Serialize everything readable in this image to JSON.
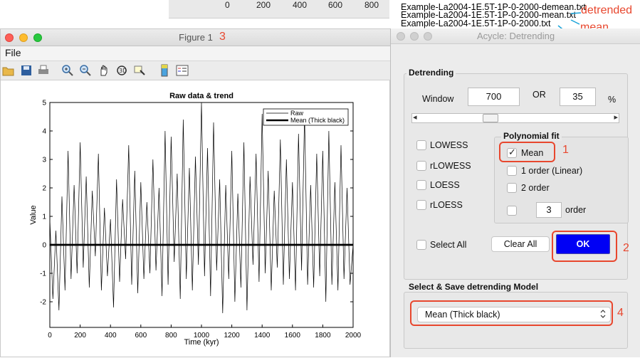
{
  "background": {
    "axis_ticks": [
      "0",
      "200",
      "400",
      "600",
      "800"
    ],
    "file_list": [
      "Example-La2004-1E.5T-1P-0-2000-demean.txt",
      "Example-La2004-1E.5T-1P-0-2000-mean.txt",
      "Example-La2004-1E.5T-1P-0-2000.txt"
    ],
    "annotations": {
      "detrended": "detrended",
      "mean": "mean",
      "n1": "1",
      "n2": "2",
      "n3": "3",
      "n4": "4"
    }
  },
  "figure": {
    "title": "Figure 1",
    "menu_file": "File",
    "toolbar_icons": [
      "open-icon",
      "save-icon",
      "print-icon",
      "zoom-in-icon",
      "zoom-out-icon",
      "pan-icon",
      "rotate-icon",
      "data-cursor-icon",
      "colorbar-icon",
      "legend-icon"
    ]
  },
  "chart_data": {
    "type": "line",
    "title": "Raw data & trend",
    "xlabel": "Time (kyr)",
    "ylabel": "Value",
    "xlim": [
      0,
      2000
    ],
    "ylim": [
      -2.9,
      5
    ],
    "xticks": [
      "0",
      "200",
      "400",
      "600",
      "800",
      "1000",
      "1200",
      "1400",
      "1600",
      "1800",
      "2000"
    ],
    "yticks": [
      "-2",
      "-1",
      "0",
      "1",
      "2",
      "3",
      "4",
      "5"
    ],
    "grid": false,
    "legend_position": "top-right",
    "series": [
      {
        "name": "Raw",
        "x": [
          0,
          20,
          40,
          60,
          80,
          100,
          120,
          140,
          160,
          180,
          200,
          220,
          240,
          260,
          280,
          300,
          320,
          340,
          360,
          380,
          400,
          420,
          440,
          460,
          480,
          500,
          520,
          540,
          560,
          580,
          600,
          620,
          640,
          660,
          680,
          700,
          720,
          740,
          760,
          780,
          800,
          820,
          840,
          860,
          880,
          900,
          920,
          940,
          960,
          980,
          1000,
          1020,
          1040,
          1060,
          1080,
          1100,
          1120,
          1140,
          1160,
          1180,
          1200,
          1220,
          1240,
          1260,
          1280,
          1300,
          1320,
          1340,
          1360,
          1380,
          1400,
          1420,
          1440,
          1460,
          1480,
          1500,
          1520,
          1540,
          1560,
          1580,
          1600,
          1620,
          1640,
          1660,
          1680,
          1700,
          1720,
          1740,
          1760,
          1780,
          1800,
          1820,
          1840,
          1860,
          1880,
          1900,
          1920,
          1940,
          1960,
          1980,
          2000
        ],
        "y": [
          0.9,
          -1.9,
          0.5,
          -2.3,
          1.7,
          -1.6,
          3.3,
          -1.2,
          2.1,
          -1.0,
          3.6,
          -0.8,
          2.4,
          -1.5,
          1.9,
          -0.4,
          3.2,
          -1.6,
          1.3,
          -1.1,
          0.9,
          -2.2,
          2.3,
          -1.3,
          1.6,
          -0.5,
          3.5,
          -1.4,
          2.6,
          -1.7,
          2.2,
          -1.2,
          1.5,
          -1.0,
          3.0,
          -0.9,
          2.0,
          -1.8,
          4.0,
          -1.4,
          3.8,
          -0.6,
          2.5,
          -1.9,
          4.4,
          -1.2,
          2.7,
          -1.6,
          3.1,
          -0.7,
          5.0,
          -1.1,
          3.4,
          -1.8,
          4.3,
          -0.9,
          2.3,
          -2.4,
          2.1,
          -1.2,
          3.3,
          -2.0,
          1.8,
          -1.5,
          3.6,
          -2.3,
          2.4,
          -0.7,
          3.2,
          -1.3,
          4.6,
          -1.0,
          2.6,
          -1.6,
          1.9,
          -0.8,
          3.7,
          -1.4,
          3.0,
          -1.2,
          2.2,
          -1.6,
          3.9,
          -0.9,
          4.6,
          -1.4,
          2.1,
          -1.5,
          3.2,
          -1.1,
          3.3,
          -2.0,
          4.0,
          -1.4,
          2.2,
          -1.6,
          3.5,
          -1.2,
          2.0,
          -1.4,
          0.0
        ]
      },
      {
        "name": "Mean (Thick black)",
        "x": [
          0,
          2000
        ],
        "y": [
          0,
          0
        ]
      }
    ]
  },
  "dialog": {
    "title": "Acycle: Detrending",
    "detrending": {
      "section_title": "Detrending",
      "window_label": "Window",
      "window_value": "700",
      "or_label": "OR",
      "percent_value": "35",
      "percent_unit": "%",
      "slider_arrow_left": "◂",
      "slider_arrow_right": "▸",
      "slider_fraction": 0.35,
      "options": [
        {
          "label": "LOWESS",
          "checked": false
        },
        {
          "label": "rLOWESS",
          "checked": false
        },
        {
          "label": "LOESS",
          "checked": false
        },
        {
          "label": "rLOESS",
          "checked": false
        }
      ],
      "poly_title": "Polynomial fit",
      "poly_mean": "Mean",
      "poly_linear": "1 order (Linear)",
      "poly_2": "2 order",
      "poly_n_value": "3",
      "poly_n_label": "order",
      "select_all": "Select All",
      "clear_all": "Clear All",
      "ok": "OK"
    },
    "model": {
      "section_title": "Select & Save detrending Model",
      "selected": "Mean (Thick black)",
      "caret": "⌃⌄"
    }
  },
  "colors": {
    "accent_red": "#e8472e",
    "annotation_blue": "#1aa3d9",
    "ok_blue": "#0000f5"
  }
}
